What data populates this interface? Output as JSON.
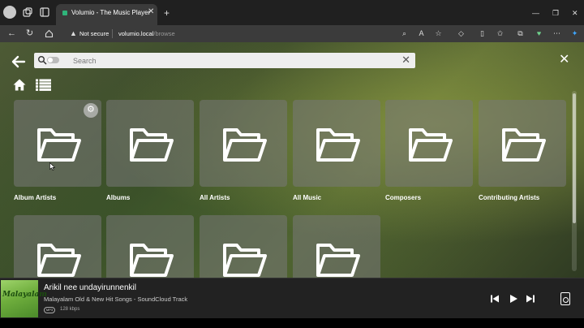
{
  "browser": {
    "tab_title": "Volumio - The Music Player",
    "security_label": "Not secure",
    "url_host": "volumio.local",
    "url_path": "/browse"
  },
  "app": {
    "search_placeholder": "Search",
    "tiles": [
      {
        "label": "Album Artists",
        "icon": "folder-icon"
      },
      {
        "label": "Albums",
        "icon": "folder-icon"
      },
      {
        "label": "All Artists",
        "icon": "folder-icon"
      },
      {
        "label": "All Music",
        "icon": "folder-icon"
      },
      {
        "label": "Composers",
        "icon": "folder-icon"
      },
      {
        "label": "Contributing Artists",
        "icon": "folder-icon"
      },
      {
        "label": "",
        "icon": "folder-icon"
      },
      {
        "label": "",
        "icon": "folder-icon"
      },
      {
        "label": "",
        "icon": "folder-icon"
      },
      {
        "label": "",
        "icon": "folder-icon"
      }
    ]
  },
  "player": {
    "cover_text": "Malayalam",
    "track_title": "Arikil nee undayirunnenkil",
    "track_subtitle": "Malayalam Old & New Hit Songs - SoundCloud Track",
    "format": "MP3",
    "bitrate": "128 kbps"
  },
  "colors": {
    "chrome_dark": "#202020",
    "chrome_bar": "#3b3b3b",
    "tile_bg": "rgba(120,120,120,0.55)",
    "player_bg": "#222222"
  }
}
